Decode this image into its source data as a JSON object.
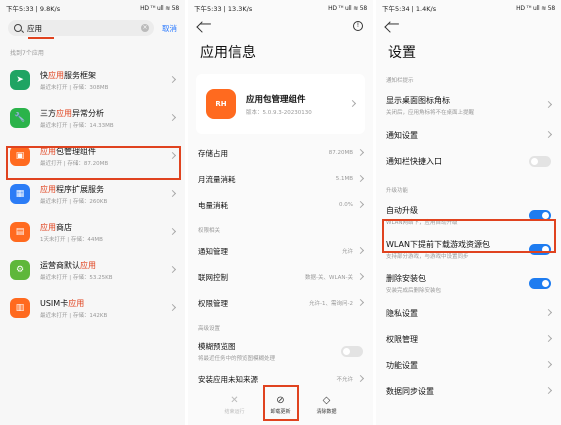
{
  "panel1": {
    "status": {
      "time": "下午5:33 | 9.8K/s",
      "icons": "HD ᵀᴴ ull ≋ 58"
    },
    "search": {
      "value": "应用",
      "cancel": "取消"
    },
    "found_label": "找到7个应用",
    "apps": [
      {
        "name_pre": "快",
        "name_hl": "应用",
        "name_post": "服务框架",
        "sub": "最近未打开 | 存储：308MB",
        "color": "#1fa463",
        "glyph": "➤"
      },
      {
        "name_pre": "三方",
        "name_hl": "应用",
        "name_post": "异常分析",
        "sub": "最近未打开 | 存储：14.33MB",
        "color": "#2bb34a",
        "glyph": "🔧"
      },
      {
        "name_pre": "",
        "name_hl": "应用",
        "name_post": "包管理组件",
        "sub": "最近打开 | 存储：87.20MB",
        "color": "#ff6a1f",
        "glyph": "▣"
      },
      {
        "name_pre": "",
        "name_hl": "应用",
        "name_post": "程序扩展服务",
        "sub": "最近未打开 | 存储：260KB",
        "color": "#2b7cf6",
        "glyph": "▦"
      },
      {
        "name_pre": "",
        "name_hl": "应用",
        "name_post": "商店",
        "sub": "1天未打开 | 存储：44MB",
        "color": "#ff6a1f",
        "glyph": "▤"
      },
      {
        "name_pre": "运营商默认",
        "name_hl": "应用",
        "name_post": "",
        "sub": "最近未打开 | 存储：53.25KB",
        "color": "#5fb73a",
        "glyph": "⚙"
      },
      {
        "name_pre": "USIM卡",
        "name_hl": "应用",
        "name_post": "",
        "sub": "最近未打开 | 存储：142KB",
        "color": "#ff6a1f",
        "glyph": "▥"
      }
    ]
  },
  "panel2": {
    "status": {
      "time": "下午5:33 | 13.3K/s",
      "icons": "HD ᵀᴴ ull ≋ 58"
    },
    "title": "应用信息",
    "pkg_name": "应用包管理组件",
    "pkg_version": "版本：5.0.9.3-20230130",
    "pkg_icon_text": "RH",
    "rows": [
      {
        "k": "存储占用",
        "v": "87.20MB"
      },
      {
        "k": "月流量消耗",
        "v": "5.1MB"
      },
      {
        "k": "电量消耗",
        "v": "0.0%"
      }
    ],
    "perm_label": "权限相关",
    "perm_rows": [
      {
        "k": "通知管理",
        "v": "允许"
      },
      {
        "k": "联网控制",
        "v": "数据-关、WLAN-关"
      },
      {
        "k": "权限管理",
        "v": "允许-1、需询问-2"
      }
    ],
    "adv_label": "高级设置",
    "blur": {
      "t": "模糊预览图",
      "s": "将最近任务中的预览图模糊处理"
    },
    "install": {
      "k": "安装应用未知来源",
      "v": "不允许"
    },
    "bottom": [
      {
        "label": "结束运行",
        "glyph": "✕",
        "disabled": true
      },
      {
        "label": "卸载更新",
        "glyph": "⊘",
        "disabled": false
      },
      {
        "label": "清除数据",
        "glyph": "◇",
        "disabled": false
      }
    ]
  },
  "panel3": {
    "status": {
      "time": "下午5:34 | 1.4K/s",
      "icons": "HD ᵀᴴ ull ≋ 58"
    },
    "title": "设置",
    "notif_label": "通知栏提示",
    "settings_a": [
      {
        "t": "显示桌面图标角标",
        "s": "关闭后，应用角标将不在桌面上提醒",
        "ctrl": "chev"
      },
      {
        "t": "通知设置",
        "s": "",
        "ctrl": "chev"
      },
      {
        "t": "通知栏快捷入口",
        "s": "",
        "ctrl": "off"
      }
    ],
    "upgrade_label": "升级功能",
    "settings_b": [
      {
        "t": "自动升级",
        "s": "WLAN网络下，应用自动升级",
        "ctrl": "on"
      },
      {
        "t": "WLAN下提前下载游戏资源包",
        "s": "支持部分游戏，与游戏中设置同步",
        "ctrl": "on"
      },
      {
        "t": "删除安装包",
        "s": "安装完成后删除安装包",
        "ctrl": "on"
      },
      {
        "t": "隐私设置",
        "s": "",
        "ctrl": "chev"
      },
      {
        "t": "权限管理",
        "s": "",
        "ctrl": "chev"
      },
      {
        "t": "功能设置",
        "s": "",
        "ctrl": "chev"
      },
      {
        "t": "数据同步设置",
        "s": "",
        "ctrl": "chev"
      }
    ]
  }
}
